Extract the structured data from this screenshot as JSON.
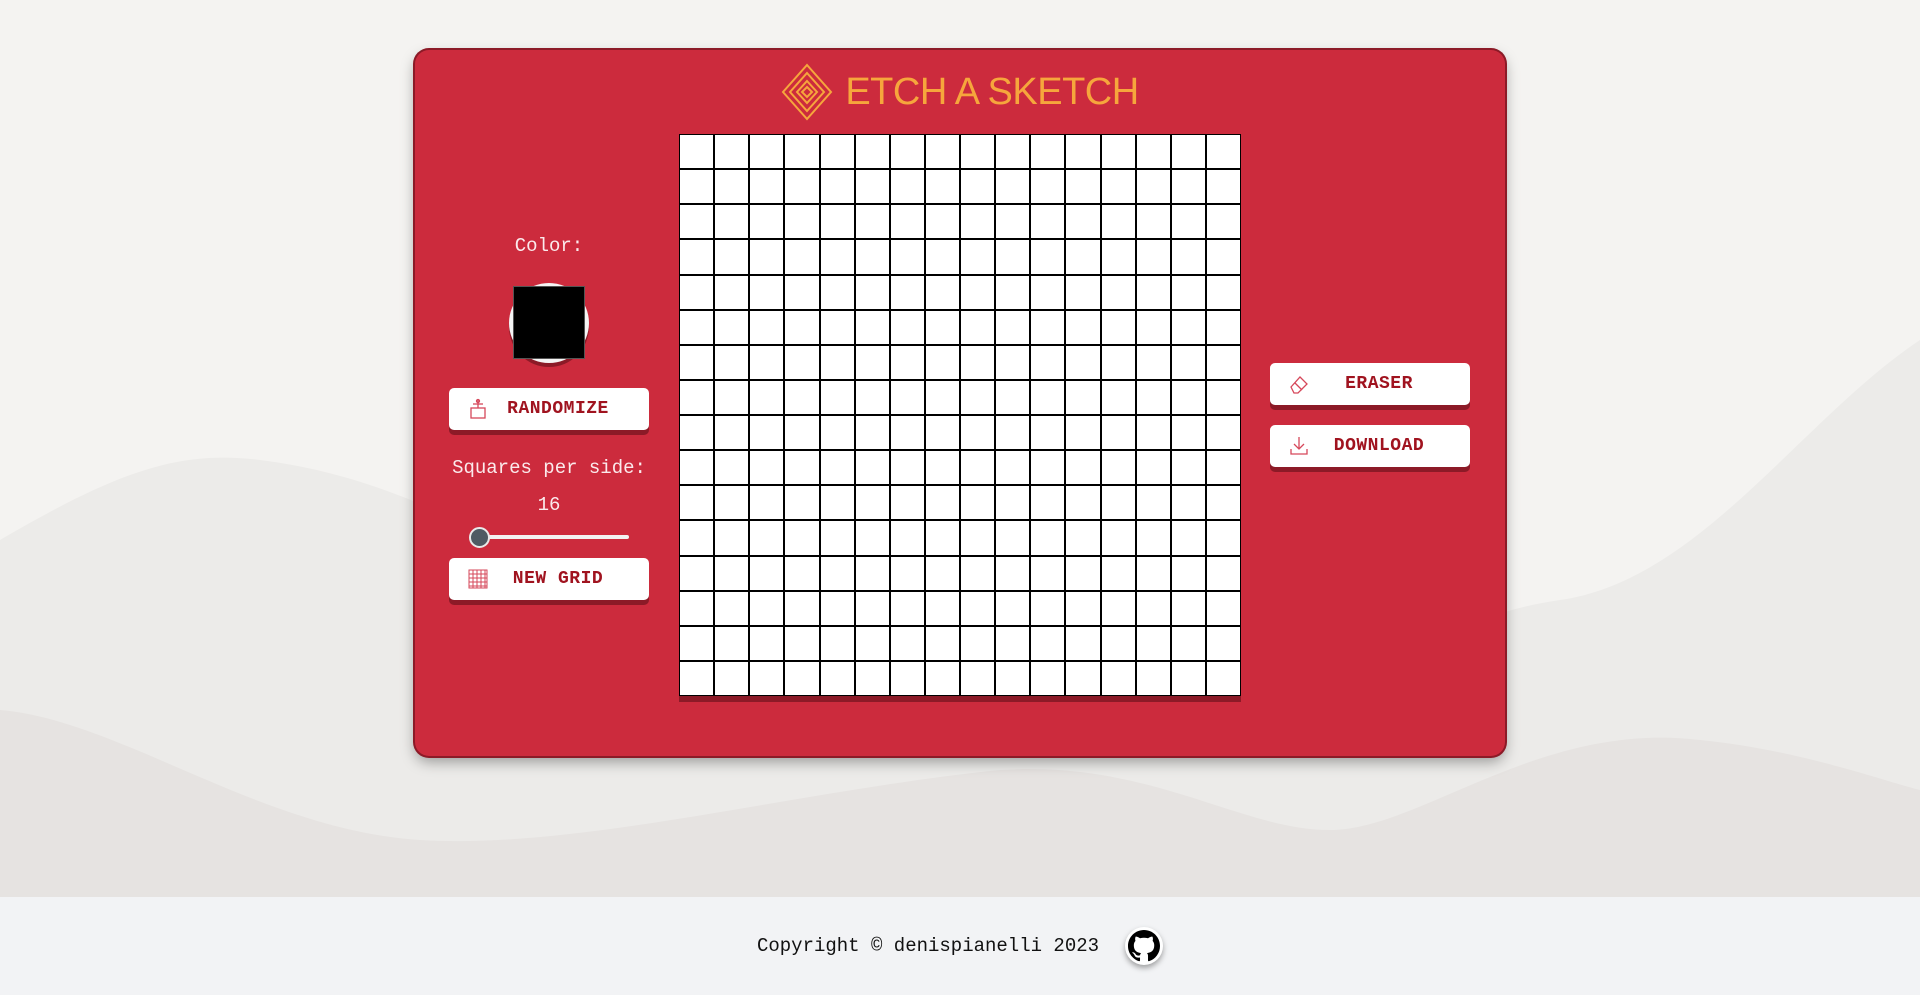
{
  "header": {
    "title": "ETCH A SKETCH"
  },
  "controls": {
    "color_label": "Color:",
    "current_color": "#000000",
    "randomize_label": "RANDOMIZE",
    "squares_label": "Squares per side:",
    "squares_value": "16",
    "new_grid_label": "NEW GRID",
    "eraser_label": "ERASER",
    "download_label": "DOWNLOAD"
  },
  "grid": {
    "squares_per_side": 16,
    "cell_color": "#ffffff",
    "line_color": "#000000"
  },
  "footer": {
    "copyright": "Copyright © denispianelli 2023"
  },
  "colors": {
    "frame": "#cc2b3d",
    "accent": "#f6a63c",
    "button_text": "#a0131f"
  }
}
